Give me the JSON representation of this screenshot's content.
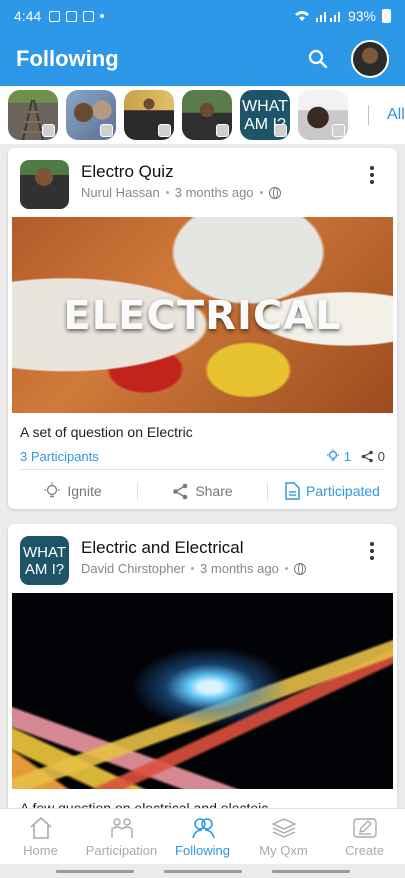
{
  "status_bar": {
    "time": "4:44",
    "battery": "93%"
  },
  "app_bar": {
    "title": "Following"
  },
  "stories": {
    "items": [
      {
        "type": "image",
        "name": "railway"
      },
      {
        "type": "image",
        "name": "selfie-group"
      },
      {
        "type": "image",
        "name": "person-standing"
      },
      {
        "type": "image",
        "name": "person-portrait"
      },
      {
        "type": "text",
        "text": "WHAT AM I?"
      },
      {
        "type": "image",
        "name": "person-dark"
      }
    ],
    "all_label": "All"
  },
  "cards": [
    {
      "title": "Electro Quiz",
      "author": "Nurul Hassan",
      "time_ago": "3 months ago",
      "banner_text": "ELECTRICAL",
      "description": "A set of question on Electric",
      "participants": "3 Participants",
      "ignite_count": "1",
      "share_count": "0",
      "actions": {
        "ignite": "Ignite",
        "share": "Share",
        "participated": "Participated"
      }
    },
    {
      "title": "Electric and Electrical",
      "author": "David Chirstopher",
      "time_ago": "3 months ago",
      "thumb_text": "WHAT AM I?",
      "description": "A few question on electrical and electeic"
    }
  ],
  "bottom_nav": [
    {
      "label": "Home",
      "icon": "home-icon"
    },
    {
      "label": "Participation",
      "icon": "participation-icon"
    },
    {
      "label": "Following",
      "icon": "following-icon"
    },
    {
      "label": "My Qxm",
      "icon": "layers-icon"
    },
    {
      "label": "Create",
      "icon": "edit-icon"
    }
  ],
  "colors": {
    "primary": "#2d97e8",
    "whatami_bg": "#1e5468"
  }
}
